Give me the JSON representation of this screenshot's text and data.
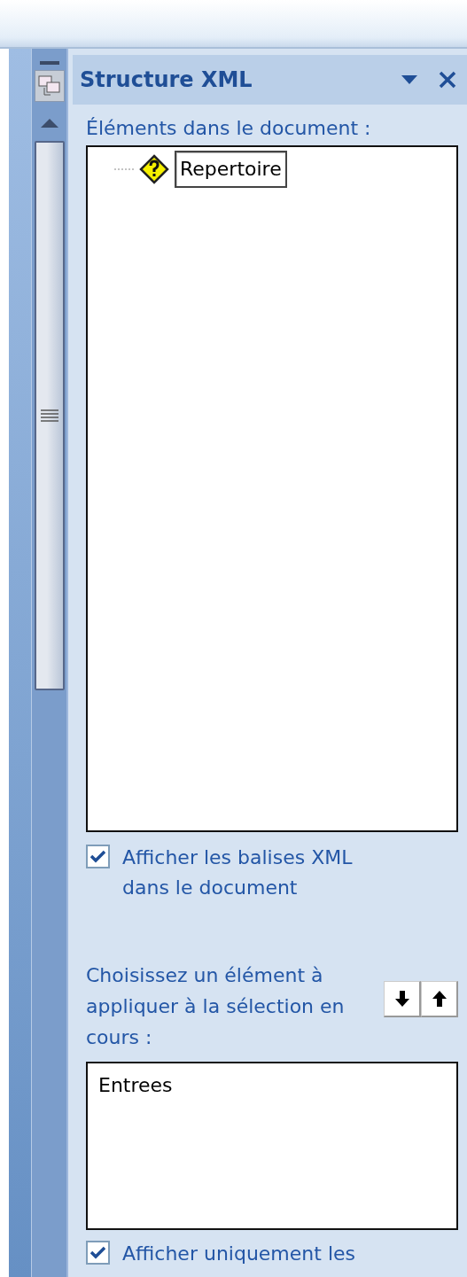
{
  "panel": {
    "title": "Structure XML"
  },
  "elements_label": "Éléments dans le document :",
  "tree": [
    {
      "label": "Repertoire",
      "kind": "unknown",
      "selected": true
    }
  ],
  "show_tags": {
    "label": "Afficher les balises XML dans le document",
    "checked": true
  },
  "choose_label": "Choisissez un élément à appliquer à la sélection en cours :",
  "element_list": [
    {
      "label": "Entrees",
      "selected": false
    }
  ],
  "show_only": {
    "label": "Afficher uniquement les",
    "checked": true
  }
}
